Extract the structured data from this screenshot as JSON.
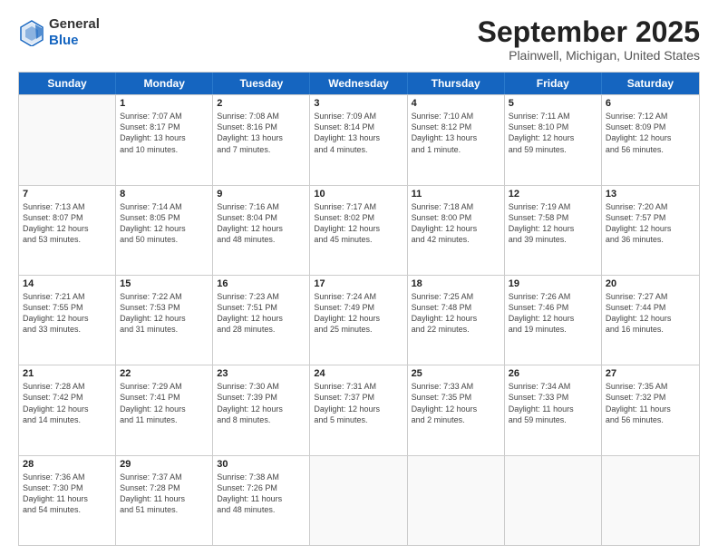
{
  "header": {
    "logo_line1": "General",
    "logo_line2": "Blue",
    "month": "September 2025",
    "location": "Plainwell, Michigan, United States"
  },
  "weekdays": [
    "Sunday",
    "Monday",
    "Tuesday",
    "Wednesday",
    "Thursday",
    "Friday",
    "Saturday"
  ],
  "weeks": [
    [
      {
        "day": "",
        "info": ""
      },
      {
        "day": "1",
        "info": "Sunrise: 7:07 AM\nSunset: 8:17 PM\nDaylight: 13 hours\nand 10 minutes."
      },
      {
        "day": "2",
        "info": "Sunrise: 7:08 AM\nSunset: 8:16 PM\nDaylight: 13 hours\nand 7 minutes."
      },
      {
        "day": "3",
        "info": "Sunrise: 7:09 AM\nSunset: 8:14 PM\nDaylight: 13 hours\nand 4 minutes."
      },
      {
        "day": "4",
        "info": "Sunrise: 7:10 AM\nSunset: 8:12 PM\nDaylight: 13 hours\nand 1 minute."
      },
      {
        "day": "5",
        "info": "Sunrise: 7:11 AM\nSunset: 8:10 PM\nDaylight: 12 hours\nand 59 minutes."
      },
      {
        "day": "6",
        "info": "Sunrise: 7:12 AM\nSunset: 8:09 PM\nDaylight: 12 hours\nand 56 minutes."
      }
    ],
    [
      {
        "day": "7",
        "info": "Sunrise: 7:13 AM\nSunset: 8:07 PM\nDaylight: 12 hours\nand 53 minutes."
      },
      {
        "day": "8",
        "info": "Sunrise: 7:14 AM\nSunset: 8:05 PM\nDaylight: 12 hours\nand 50 minutes."
      },
      {
        "day": "9",
        "info": "Sunrise: 7:16 AM\nSunset: 8:04 PM\nDaylight: 12 hours\nand 48 minutes."
      },
      {
        "day": "10",
        "info": "Sunrise: 7:17 AM\nSunset: 8:02 PM\nDaylight: 12 hours\nand 45 minutes."
      },
      {
        "day": "11",
        "info": "Sunrise: 7:18 AM\nSunset: 8:00 PM\nDaylight: 12 hours\nand 42 minutes."
      },
      {
        "day": "12",
        "info": "Sunrise: 7:19 AM\nSunset: 7:58 PM\nDaylight: 12 hours\nand 39 minutes."
      },
      {
        "day": "13",
        "info": "Sunrise: 7:20 AM\nSunset: 7:57 PM\nDaylight: 12 hours\nand 36 minutes."
      }
    ],
    [
      {
        "day": "14",
        "info": "Sunrise: 7:21 AM\nSunset: 7:55 PM\nDaylight: 12 hours\nand 33 minutes."
      },
      {
        "day": "15",
        "info": "Sunrise: 7:22 AM\nSunset: 7:53 PM\nDaylight: 12 hours\nand 31 minutes."
      },
      {
        "day": "16",
        "info": "Sunrise: 7:23 AM\nSunset: 7:51 PM\nDaylight: 12 hours\nand 28 minutes."
      },
      {
        "day": "17",
        "info": "Sunrise: 7:24 AM\nSunset: 7:49 PM\nDaylight: 12 hours\nand 25 minutes."
      },
      {
        "day": "18",
        "info": "Sunrise: 7:25 AM\nSunset: 7:48 PM\nDaylight: 12 hours\nand 22 minutes."
      },
      {
        "day": "19",
        "info": "Sunrise: 7:26 AM\nSunset: 7:46 PM\nDaylight: 12 hours\nand 19 minutes."
      },
      {
        "day": "20",
        "info": "Sunrise: 7:27 AM\nSunset: 7:44 PM\nDaylight: 12 hours\nand 16 minutes."
      }
    ],
    [
      {
        "day": "21",
        "info": "Sunrise: 7:28 AM\nSunset: 7:42 PM\nDaylight: 12 hours\nand 14 minutes."
      },
      {
        "day": "22",
        "info": "Sunrise: 7:29 AM\nSunset: 7:41 PM\nDaylight: 12 hours\nand 11 minutes."
      },
      {
        "day": "23",
        "info": "Sunrise: 7:30 AM\nSunset: 7:39 PM\nDaylight: 12 hours\nand 8 minutes."
      },
      {
        "day": "24",
        "info": "Sunrise: 7:31 AM\nSunset: 7:37 PM\nDaylight: 12 hours\nand 5 minutes."
      },
      {
        "day": "25",
        "info": "Sunrise: 7:33 AM\nSunset: 7:35 PM\nDaylight: 12 hours\nand 2 minutes."
      },
      {
        "day": "26",
        "info": "Sunrise: 7:34 AM\nSunset: 7:33 PM\nDaylight: 11 hours\nand 59 minutes."
      },
      {
        "day": "27",
        "info": "Sunrise: 7:35 AM\nSunset: 7:32 PM\nDaylight: 11 hours\nand 56 minutes."
      }
    ],
    [
      {
        "day": "28",
        "info": "Sunrise: 7:36 AM\nSunset: 7:30 PM\nDaylight: 11 hours\nand 54 minutes."
      },
      {
        "day": "29",
        "info": "Sunrise: 7:37 AM\nSunset: 7:28 PM\nDaylight: 11 hours\nand 51 minutes."
      },
      {
        "day": "30",
        "info": "Sunrise: 7:38 AM\nSunset: 7:26 PM\nDaylight: 11 hours\nand 48 minutes."
      },
      {
        "day": "",
        "info": ""
      },
      {
        "day": "",
        "info": ""
      },
      {
        "day": "",
        "info": ""
      },
      {
        "day": "",
        "info": ""
      }
    ]
  ]
}
